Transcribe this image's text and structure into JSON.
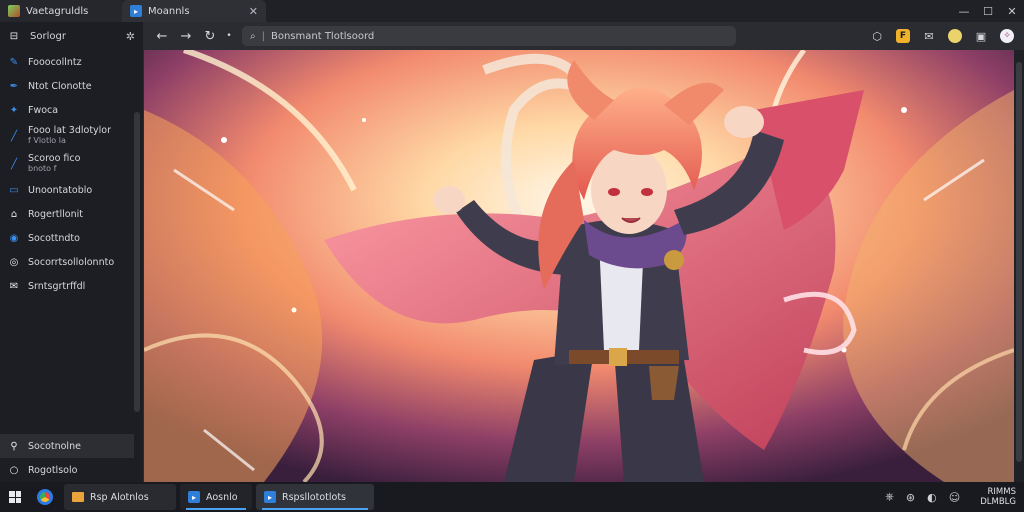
{
  "titlebar": {
    "tabs": [
      {
        "title": "Vaetagruldls"
      },
      {
        "title": "Moannls",
        "close": "✕"
      }
    ],
    "controls": {
      "min": "—",
      "max": "☐",
      "close": "✕"
    }
  },
  "toolbar": {
    "back": "←",
    "forward": "→",
    "reload": "↻",
    "address_separator": "|",
    "address_text": "Bonsmant Tlotlsoord",
    "ext_badge": "F"
  },
  "sidebar": {
    "header": "Sorlogr",
    "items": [
      {
        "label": "Fooocollntz",
        "icon": "edit-icon"
      },
      {
        "label": "Ntot Clonotte",
        "icon": "pen-icon"
      },
      {
        "label": "Fwoca",
        "icon": "puzzle-icon"
      },
      {
        "label": "Fooo lat 3dlotylor",
        "sub": "f Vlotlo la",
        "icon": "pencil-icon"
      },
      {
        "label": "Scoroo fico",
        "sub": "bnoto f",
        "icon": "pencil-icon"
      },
      {
        "label": "Unoontatoblo",
        "icon": "monitor-icon"
      },
      {
        "label": "Rogertllonit",
        "icon": "home-icon"
      },
      {
        "label": "Socottndto",
        "icon": "globe-icon"
      },
      {
        "label": "Socorrtsollolonnto",
        "icon": "record-icon"
      },
      {
        "label": "Srntsgrtrffdl",
        "icon": "mail-icon"
      }
    ],
    "bottom": [
      {
        "label": "Socotnolne",
        "icon": "magnifier-icon"
      },
      {
        "label": "Rogotlsolo",
        "icon": "circle-icon"
      }
    ]
  },
  "taskbar": {
    "apps": [
      {
        "label": "Rsp Alotnlos"
      },
      {
        "label": "Aosnlo"
      },
      {
        "label": "Rspsllototlots"
      }
    ],
    "clock": {
      "time": "RIMMS",
      "date": "DLMBLG"
    }
  },
  "colors": {
    "accent": "#3b8eea",
    "chrome": "#202126",
    "sidebar": "#1d1e23",
    "taskbar": "#191a1f"
  }
}
